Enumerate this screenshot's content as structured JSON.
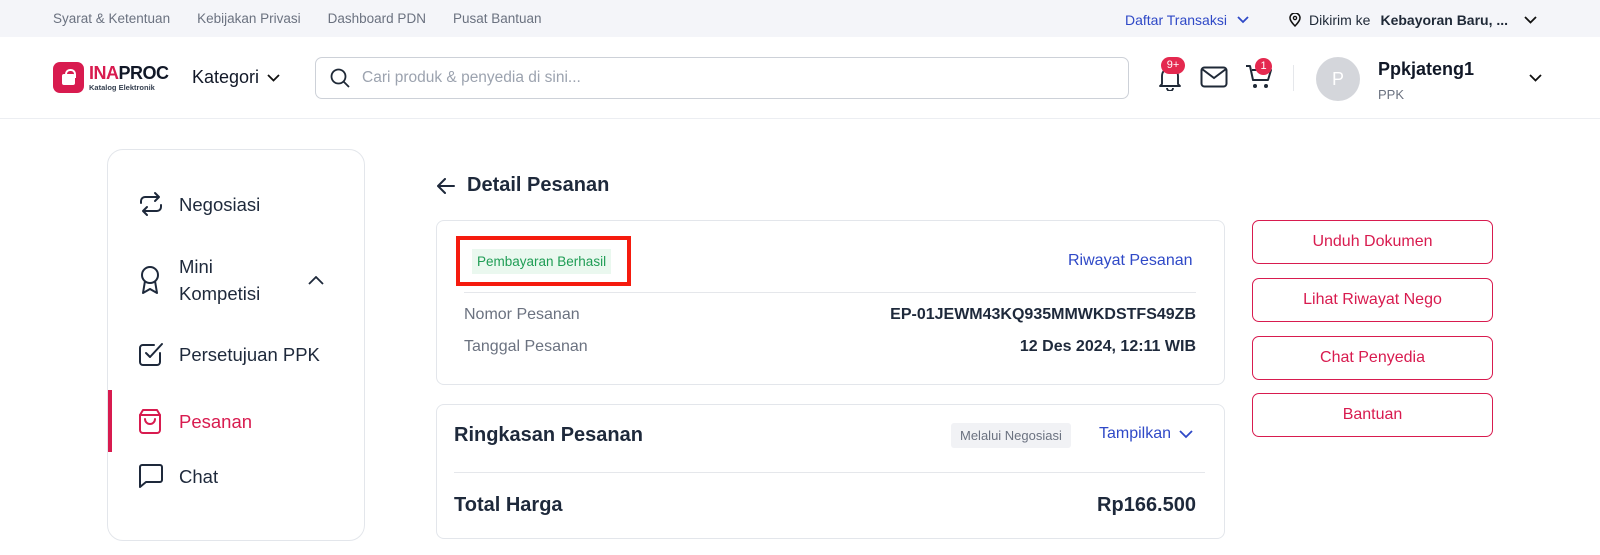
{
  "topbar": {
    "links": [
      "Syarat & Ketentuan",
      "Kebijakan Privasi",
      "Dashboard PDN",
      "Pusat Bantuan"
    ],
    "transactions_label": "Daftar Transaksi",
    "ship_prefix": "Dikirim ke",
    "ship_location": "Kebayoran Baru, ..."
  },
  "header": {
    "logo_brand_a": "INA",
    "logo_brand_b": "PROC",
    "logo_tagline": "Katalog Elektronik",
    "category_label": "Kategori",
    "search_placeholder": "Cari produk & penyedia di sini...",
    "notification_count": "9+",
    "cart_count": "1",
    "user_initial": "P",
    "user_name": "Ppkjateng1",
    "user_role": "PPK"
  },
  "sidebar": {
    "items": [
      {
        "label": "Negosiasi",
        "icon": "arrows-swap-icon"
      },
      {
        "label": "Mini Kompetisi",
        "icon": "award-icon"
      },
      {
        "label": "Persetujuan PPK",
        "icon": "checkbox-icon"
      },
      {
        "label": "Pesanan",
        "icon": "shopping-bag-icon",
        "active": true
      },
      {
        "label": "Chat",
        "icon": "chat-icon"
      }
    ]
  },
  "main": {
    "page_title": "Detail Pesanan",
    "status_badge": "Pembayaran Berhasil",
    "history_link": "Riwayat Pesanan",
    "order_number_label": "Nomor Pesanan",
    "order_number": "EP-01JEWM43KQ935MMWKDSTFS49ZB",
    "order_date_label": "Tanggal Pesanan",
    "order_date": "12 Des 2024, 12:11 WIB",
    "summary_title": "Ringkasan Pesanan",
    "summary_chip": "Melalui Negosiasi",
    "summary_toggle": "Tampilkan",
    "total_label": "Total Harga",
    "total_value": "Rp166.500"
  },
  "actions": [
    "Unduh Dokumen",
    "Lihat Riwayat Nego",
    "Chat Penyedia",
    "Bantuan"
  ],
  "colors": {
    "brand": "#d81b4f",
    "link": "#2f49c7",
    "success": "#1f9d55",
    "highlight": "#f51b0e"
  }
}
